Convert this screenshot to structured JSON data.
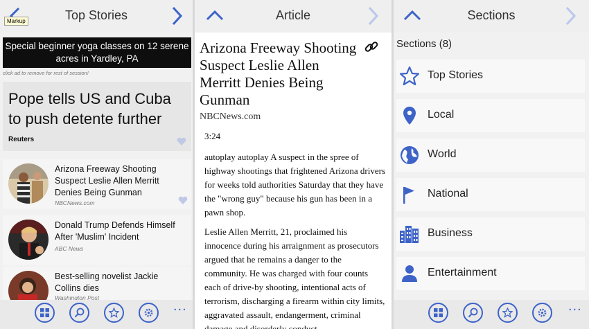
{
  "tooltip": "Markup",
  "colors": {
    "accent": "#3d63c9",
    "nav_disabled": "#b9c7ea",
    "heart": "#bfc9e6"
  },
  "top_stories": {
    "title": "Top Stories",
    "ad_text": "Special beginner yoga classes on 12 serene acres in Yardley, PA",
    "ad_note": "click ad to remove for rest of session!",
    "featured": {
      "title": "Pope tells US and Cuba to push detente further",
      "source": "Reuters"
    },
    "stories": [
      {
        "title": "Arizona Freeway Shooting Suspect Leslie Allen Merritt Denies Being Gunman",
        "source": "NBCNews.com"
      },
      {
        "title": "Donald Trump Defends Himself After 'Muslim' Incident",
        "source": "ABC News"
      },
      {
        "title": "Best-selling novelist Jackie Collins dies",
        "source": "Washington Post"
      }
    ],
    "more_label": "..."
  },
  "article": {
    "header": "Article",
    "title": "Arizona Freeway Shooting Suspect Leslie Allen Merritt Denies Being Gunman",
    "source": "NBCNews.com",
    "duration": "3:24",
    "paragraphs": [
      "autoplay autoplay A suspect in the spree of highway shootings that frightened Arizona drivers for weeks told authorities Saturday that they have the \"wrong guy\" because his gun has been in a pawn shop.",
      "Leslie Allen Merritt, 21, proclaimed his innocence during his arraignment as prosecutors argued that he remains a danger to the community. He was charged with four counts each of drive-by shooting, intentional acts of terrorism, discharging a firearm within city limits, aggravated assault, endangerment, criminal damage and disorderly conduct."
    ]
  },
  "sections": {
    "title": "Sections",
    "header": "Sections (8)",
    "items": [
      {
        "label": "Top Stories",
        "icon": "star-icon"
      },
      {
        "label": "Local",
        "icon": "map-pin-icon"
      },
      {
        "label": "World",
        "icon": "globe-icon"
      },
      {
        "label": "National",
        "icon": "flag-icon"
      },
      {
        "label": "Business",
        "icon": "buildings-icon"
      },
      {
        "label": "Entertainment",
        "icon": "person-icon"
      }
    ],
    "more_label": "..."
  }
}
